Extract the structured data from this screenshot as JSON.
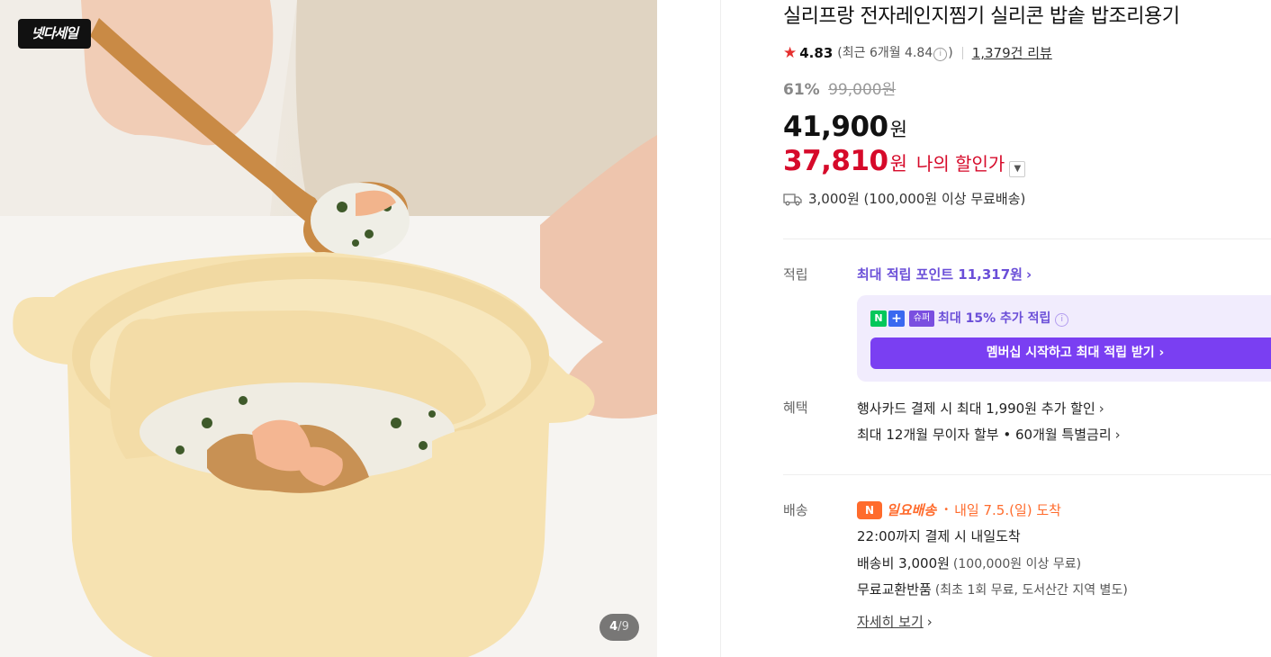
{
  "image": {
    "badge": "넷다세일",
    "counter_current": "4",
    "counter_total": "9"
  },
  "product": {
    "title": "실리프랑 전자레인지찜기 실리콘 밥솥 밥조리용기",
    "rating": "4.83",
    "recent_rating": "(최근 6개월 4.84",
    "recent_rating_close": ")",
    "review_count": "1,379건 리뷰",
    "discount_pct": "61%",
    "original_price": "99,000원",
    "price": "41,900",
    "price_unit": "원",
    "my_price": "37,810",
    "my_price_unit": "원",
    "my_price_label": "나의 할인가",
    "shipping_fee_line": "3,000원 (100,000원 이상 무료배송)"
  },
  "points": {
    "label": "적립",
    "max_points": "최대 적립 포인트 11,317원",
    "np_n": "N",
    "np_plus": "+",
    "np_super": "슈퍼",
    "extra": "최대 15% 추가 적립",
    "member_button": "멤버십 시작하고 최대 적립 받기"
  },
  "benefits": {
    "label": "혜택",
    "card": "행사카드 결제 시 최대 1,990원 추가 할인",
    "installment": "최대 12개월 무이자 할부 • 60개월 특별금리"
  },
  "delivery": {
    "label": "배송",
    "badge": "일요배송",
    "arrive": "내일 7.5.(일) 도착",
    "cutoff": "22:00까지 결제 시 내일도착",
    "fee": "배송비 3,000원",
    "fee_sub": "(100,000원 이상 무료)",
    "exchange": "무료교환반품",
    "exchange_sub": "(최초 1회 무료, 도서산간 지역 별도)",
    "detail": "자세히 보기"
  },
  "colors": {
    "accent_purple": "#7a3ff2",
    "sale_red": "#d60a2a",
    "delivery_orange": "#ff6b2c",
    "star_red": "#e5302f"
  }
}
